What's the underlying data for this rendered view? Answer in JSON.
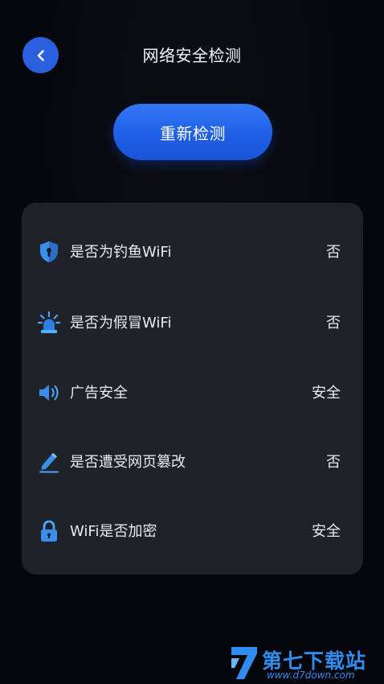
{
  "header": {
    "title": "网络安全检测",
    "back_icon": "chevron-left-icon"
  },
  "actions": {
    "recheck_label": "重新检测",
    "accent": "#2563eb"
  },
  "checks": [
    {
      "icon": "shield-icon",
      "label": "是否为钓鱼WiFi",
      "value": "否"
    },
    {
      "icon": "alarm-light-icon",
      "label": "是否为假冒WiFi",
      "value": "否"
    },
    {
      "icon": "speaker-icon",
      "label": "广告安全",
      "value": "安全"
    },
    {
      "icon": "pencil-icon",
      "label": "是否遭受网页篡改",
      "value": "否"
    },
    {
      "icon": "lock-icon",
      "label": "WiFi是否加密",
      "value": "安全"
    }
  ],
  "watermark": {
    "text": "第七下载站",
    "url": "www.d7down.com"
  }
}
